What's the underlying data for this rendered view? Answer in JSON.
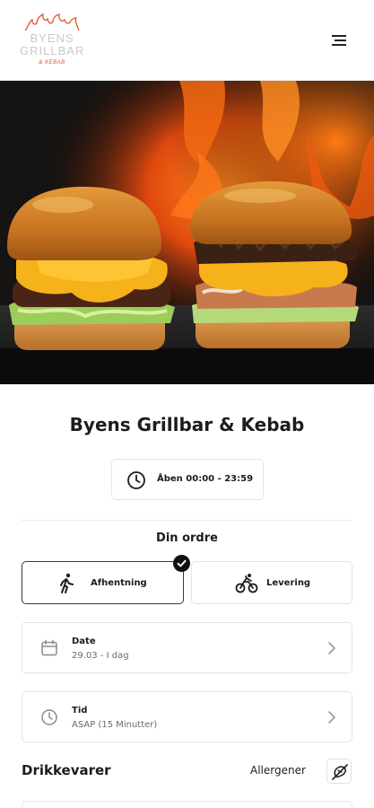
{
  "header": {
    "logo": {
      "line1": "BYENS",
      "line2": "GRILLBAR",
      "line3": "& KEBAB"
    }
  },
  "hero": {
    "image_alt": "burgers-in-front-of-flames"
  },
  "shop": {
    "name": "Byens Grillbar & Kebab",
    "hours": "Åben 00:00 - 23:59"
  },
  "order": {
    "title": "Din ordre",
    "options": [
      {
        "label": "Afhentning",
        "icon": "walking-person-icon",
        "selected": true
      },
      {
        "label": "Levering",
        "icon": "bicycle-icon",
        "selected": false
      }
    ],
    "date": {
      "title": "Date",
      "value": "29.03 - I dag"
    },
    "time": {
      "title": "Tid",
      "value": "ASAP (15 Minutter)"
    }
  },
  "menu": {
    "section_title": "Drikkevarer",
    "allergen_label": "Allergener"
  },
  "colors": {
    "accent": "#e1542a",
    "text": "#1c1c1c",
    "border": "#e4e4e4"
  }
}
